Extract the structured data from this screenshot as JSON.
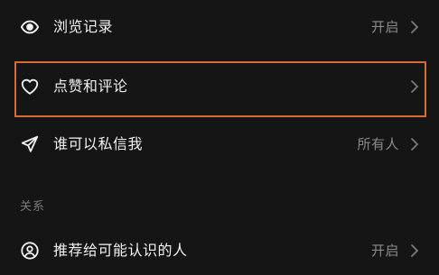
{
  "rows": [
    {
      "label": "浏览记录",
      "value": "开启",
      "icon": "eye-icon"
    },
    {
      "label": "点赞和评论",
      "value": "",
      "icon": "heart-icon"
    },
    {
      "label": "谁可以私信我",
      "value": "所有人",
      "icon": "send-icon"
    },
    {
      "label": "推荐给可能认识的人",
      "value": "开启",
      "icon": "person-circle-icon"
    }
  ],
  "sections": {
    "relations_label": "关系"
  },
  "colors": {
    "background": "#151515",
    "highlight_border": "#d86a32",
    "secondary_text": "#8a8a8a"
  }
}
